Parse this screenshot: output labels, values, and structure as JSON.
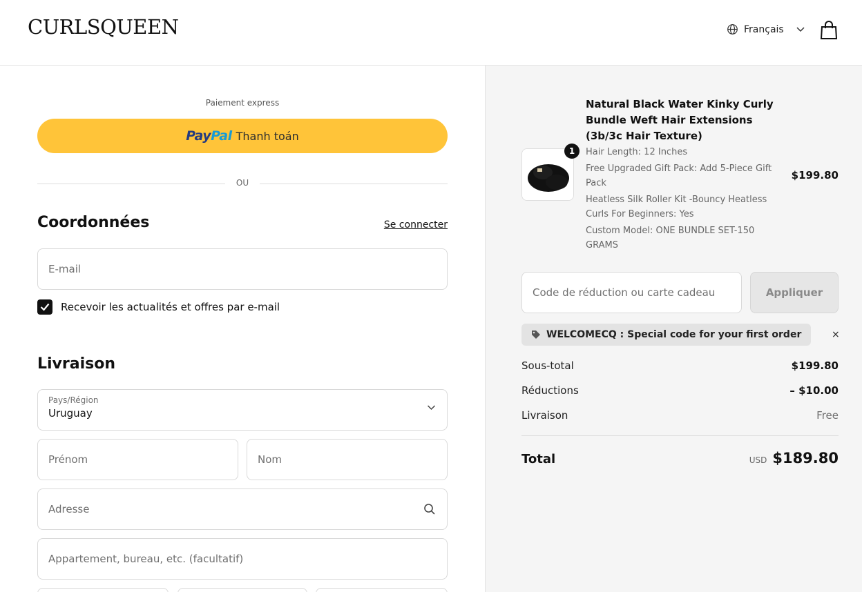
{
  "header": {
    "logo": "CURLSQUEEN",
    "language": "Français"
  },
  "express": {
    "title": "Paiement express",
    "paypal_brand_1": "Pay",
    "paypal_brand_2": "Pal",
    "paypal_label": "Thanh toán",
    "or_label": "OU"
  },
  "contact": {
    "title": "Coordonnées",
    "login_link": "Se connecter",
    "email_placeholder": "E-mail",
    "newsletter_label": "Recevoir les actualités et offres par e-mail",
    "newsletter_checked": true
  },
  "delivery": {
    "title": "Livraison",
    "country_label": "Pays/Région",
    "country_value": "Uruguay",
    "first_name_placeholder": "Prénom",
    "last_name_placeholder": "Nom",
    "address_placeholder": "Adresse",
    "apartment_placeholder": "Appartement, bureau, etc. (facultatif)"
  },
  "summary": {
    "product": {
      "name": "Natural Black Water Kinky Curly Bundle Weft Hair Extensions (3b/3c Hair Texture)",
      "quantity": "1",
      "variants": [
        "Hair Length: 12 Inches",
        "Free Upgraded Gift Pack: Add 5-Piece Gift Pack",
        "Heatless Silk Roller Kit -Bouncy Heatless Curls For Beginners: Yes",
        "Custom Model: ONE BUNDLE SET-150 GRAMS"
      ],
      "price": "$199.80"
    },
    "discount_placeholder": "Code de réduction ou carte cadeau",
    "apply_label": "Appliquer",
    "applied_code": "WELCOMECQ : Special code for your first order",
    "remove_label": "×",
    "subtotal_label": "Sous-total",
    "subtotal_value": "$199.80",
    "discount_label": "Réductions",
    "discount_value": "– $10.00",
    "shipping_label": "Livraison",
    "shipping_value": "Free",
    "total_label": "Total",
    "currency": "USD",
    "total_value": "$189.80"
  },
  "colors": {
    "paypal_yellow": "#ffc439",
    "paypal_dark_blue": "#253b80",
    "paypal_light_blue": "#179bd7",
    "summary_bg": "#f5f5f5"
  }
}
